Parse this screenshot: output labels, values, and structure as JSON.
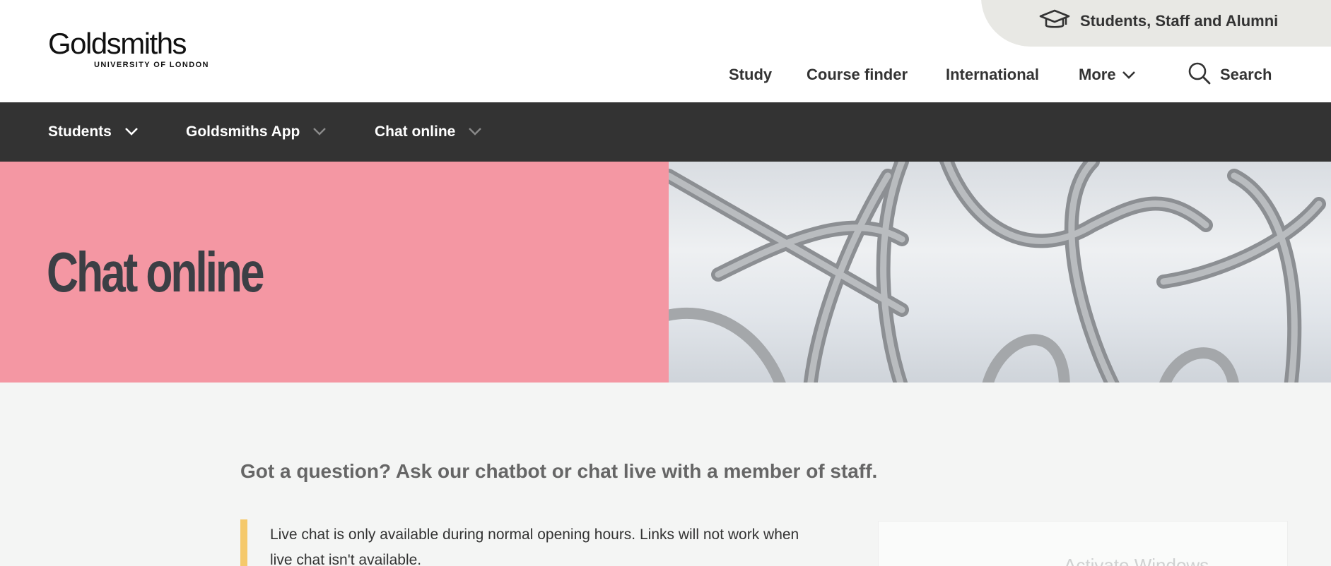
{
  "header": {
    "logo_name": "Goldsmiths",
    "logo_sub": "UNIVERSITY OF LONDON",
    "audience_link": "Students, Staff and Alumni",
    "nav": [
      {
        "label": "Study"
      },
      {
        "label": "Course finder"
      },
      {
        "label": "International"
      },
      {
        "label": "More"
      }
    ],
    "search_label": "Search"
  },
  "subnav": [
    {
      "label": "Students"
    },
    {
      "label": "Goldsmiths App"
    },
    {
      "label": "Chat online"
    }
  ],
  "hero": {
    "title": "Chat online",
    "accent_color": "#f497a3"
  },
  "content": {
    "intro": "Got a question? Ask our chatbot or chat live with a member of staff.",
    "notice_line1": "Live chat is only available during normal opening hours. Links will not work when",
    "notice_line2": "live chat isn't available.",
    "notice_color": "#f5c96b"
  },
  "watermark": "Activate Windows",
  "icons": {
    "audience": "graduation-cap-icon",
    "more": "chevron-down-icon",
    "search": "search-icon"
  }
}
